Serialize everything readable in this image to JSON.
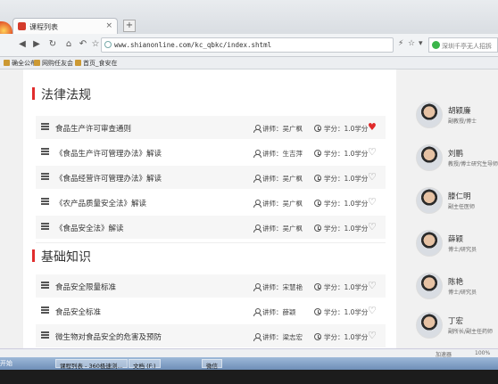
{
  "browser": {
    "tab_title": "课程列表",
    "tab_close": "×",
    "new_tab": "+",
    "url": "www.shianonline.com/kc_qbkc/index.shtml",
    "search_placeholder": "深圳千亭无人招拆",
    "bookmarks": [
      "确全公布",
      "网购任友会",
      "首页_食安在"
    ]
  },
  "sections": [
    {
      "title": "法律法规",
      "courses": [
        {
          "title": "食品生产许可审查通则",
          "teacher": "讲师：吴广枫",
          "credits": "学分：1.0学分",
          "favorited": true
        },
        {
          "title": "《食品生产许可管理办法》解读",
          "teacher": "讲师：生吉萍",
          "credits": "学分：1.0学分",
          "favorited": false
        },
        {
          "title": "《食品经营许可管理办法》解读",
          "teacher": "讲师：吴广枫",
          "credits": "学分：1.0学分",
          "favorited": false
        },
        {
          "title": "《农产品质量安全法》解读",
          "teacher": "讲师：吴广枫",
          "credits": "学分：1.0学分",
          "favorited": false
        },
        {
          "title": "《食品安全法》解读",
          "teacher": "讲师：吴广枫",
          "credits": "学分：1.0学分",
          "favorited": false
        }
      ]
    },
    {
      "title": "基础知识",
      "courses": [
        {
          "title": "食品安全限量标准",
          "teacher": "讲师：宋慧艳",
          "credits": "学分：1.0学分",
          "favorited": false
        },
        {
          "title": "食品安全标准",
          "teacher": "讲师：薛颖",
          "credits": "学分：1.0学分",
          "favorited": false
        },
        {
          "title": "微生物对食品安全的危害及预防",
          "teacher": "讲师：梁志宏",
          "credits": "学分：1.0学分",
          "favorited": false
        }
      ]
    }
  ],
  "teachers": [
    {
      "name": "胡颖廉",
      "title": "副教授/博士"
    },
    {
      "name": "刘鹏",
      "title": "教授/博士研究生导师"
    },
    {
      "name": "滕仁明",
      "title": "副主任医师"
    },
    {
      "name": "薛颖",
      "title": "博士/研究员"
    },
    {
      "name": "陈艳",
      "title": "博士/研究员"
    },
    {
      "name": "丁宏",
      "title": "副所长/副主任药师"
    }
  ],
  "statusbar": {
    "zoom": "100%",
    "download": "加速器"
  },
  "taskbar": {
    "start": "开始",
    "items": [
      "课程列表 - 360极速浏...",
      "文档 (F:)",
      "微信"
    ]
  },
  "colors": {
    "accent": "#e12d2d",
    "heart_on": "#e02a2a"
  }
}
